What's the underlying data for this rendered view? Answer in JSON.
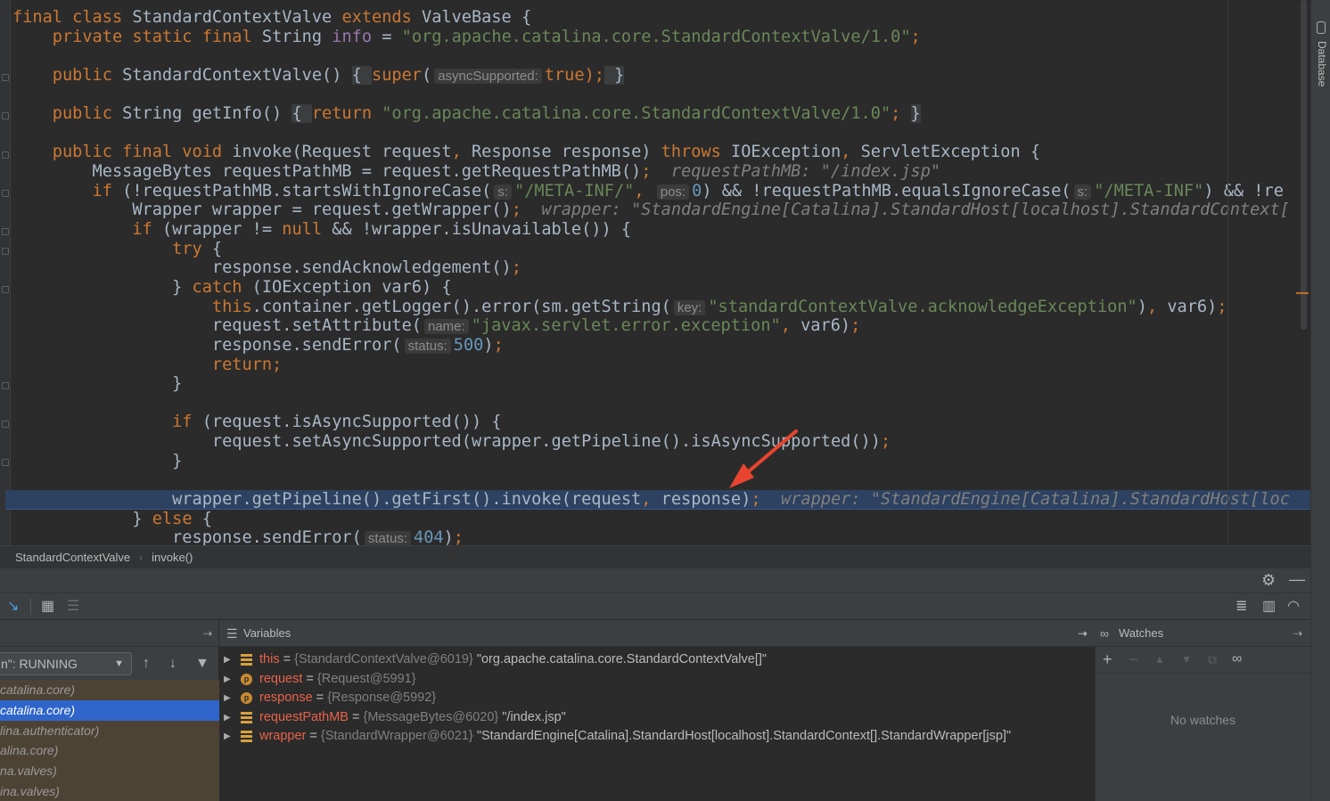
{
  "editor": {
    "lines": [
      [
        {
          "t": "final class ",
          "c": "kw"
        },
        {
          "t": "StandardContextValve "
        },
        {
          "t": "extends ",
          "c": "kw"
        },
        {
          "t": "ValveBase {"
        }
      ],
      [
        {
          "t": "    private static final ",
          "c": "kw"
        },
        {
          "t": "String "
        },
        {
          "t": "info",
          "c": "purple"
        },
        {
          "t": " = "
        },
        {
          "t": "\"org.apache.catalina.core.StandardContextValve/1.0\"",
          "c": "str"
        },
        {
          "t": ";",
          "c": "kw"
        }
      ],
      [],
      [
        {
          "t": "    public ",
          "c": "kw"
        },
        {
          "t": "StandardContextValve() "
        },
        {
          "t": "{ ",
          "c": "fold-brace"
        },
        {
          "t": "super",
          "c": "kw"
        },
        {
          "t": "("
        },
        {
          "t": "asyncSupported:",
          "c": "hint"
        },
        {
          "t": "true",
          "c": "kw"
        },
        {
          "t": ");",
          "c": "kw"
        },
        {
          "t": " }",
          "c": "fold-brace"
        }
      ],
      [],
      [
        {
          "t": "    public ",
          "c": "kw"
        },
        {
          "t": "String getInfo() "
        },
        {
          "t": "{ ",
          "c": "fold-brace"
        },
        {
          "t": "return ",
          "c": "kw"
        },
        {
          "t": "\"org.apache.catalina.core.StandardContextValve/1.0\"",
          "c": "str"
        },
        {
          "t": "; ",
          "c": "kw"
        },
        {
          "t": "}",
          "c": "fold-brace"
        }
      ],
      [],
      [
        {
          "t": "    public final void ",
          "c": "kw"
        },
        {
          "t": "invoke(Request request"
        },
        {
          "t": ", ",
          "c": "kw"
        },
        {
          "t": "Response response) "
        },
        {
          "t": "throws ",
          "c": "kw"
        },
        {
          "t": "IOException"
        },
        {
          "t": ", ",
          "c": "kw"
        },
        {
          "t": "ServletException {"
        }
      ],
      [
        {
          "t": "        MessageBytes requestPathMB = request.getRequestPathMB()"
        },
        {
          "t": ";",
          "c": "kw"
        },
        {
          "t": "  requestPathMB: \"/index.jsp\"",
          "c": "comment"
        }
      ],
      [
        {
          "t": "        if ",
          "c": "kw"
        },
        {
          "t": "(!requestPathMB.startsWithIgnoreCase("
        },
        {
          "t": "s:",
          "c": "hint"
        },
        {
          "t": "\"/META-INF/\"",
          "c": "str"
        },
        {
          "t": ", ",
          "c": "kw"
        },
        {
          "t": "pos:",
          "c": "hint"
        },
        {
          "t": "0",
          "c": "num"
        },
        {
          "t": ") && !requestPathMB.equalsIgnoreCase("
        },
        {
          "t": "s:",
          "c": "hint"
        },
        {
          "t": "\"/META-INF\"",
          "c": "str"
        },
        {
          "t": ") && !re"
        }
      ],
      [
        {
          "t": "            Wrapper wrapper = request.getWrapper()"
        },
        {
          "t": ";",
          "c": "kw"
        },
        {
          "t": "  wrapper: \"StandardEngine[Catalina].StandardHost[localhost].StandardContext[",
          "c": "comment"
        }
      ],
      [
        {
          "t": "            if ",
          "c": "kw"
        },
        {
          "t": "(wrapper != "
        },
        {
          "t": "null ",
          "c": "kw"
        },
        {
          "t": "&& !wrapper.isUnavailable()) {"
        }
      ],
      [
        {
          "t": "                try ",
          "c": "kw"
        },
        {
          "t": "{"
        }
      ],
      [
        {
          "t": "                    response.sendAcknowledgement()"
        },
        {
          "t": ";",
          "c": "kw"
        }
      ],
      [
        {
          "t": "                } "
        },
        {
          "t": "catch ",
          "c": "kw"
        },
        {
          "t": "(IOException var6) {"
        }
      ],
      [
        {
          "t": "                    this",
          "c": "kw"
        },
        {
          "t": ".container.getLogger().error(sm.getString("
        },
        {
          "t": "key:",
          "c": "hint"
        },
        {
          "t": "\"standardContextValve.acknowledgeException\"",
          "c": "str"
        },
        {
          "t": ")"
        },
        {
          "t": ", ",
          "c": "kw"
        },
        {
          "t": "var6)"
        },
        {
          "t": ";",
          "c": "kw"
        }
      ],
      [
        {
          "t": "                    request.setAttribute("
        },
        {
          "t": "name:",
          "c": "hint"
        },
        {
          "t": "\"javax.servlet.error.exception\"",
          "c": "str"
        },
        {
          "t": ", ",
          "c": "kw"
        },
        {
          "t": "var6)"
        },
        {
          "t": ";",
          "c": "kw"
        }
      ],
      [
        {
          "t": "                    response.sendError("
        },
        {
          "t": "status:",
          "c": "hint"
        },
        {
          "t": "500",
          "c": "num"
        },
        {
          "t": ")"
        },
        {
          "t": ";",
          "c": "kw"
        }
      ],
      [
        {
          "t": "                    return;",
          "c": "kw"
        }
      ],
      [
        {
          "t": "                }"
        }
      ],
      [],
      [
        {
          "t": "                if ",
          "c": "kw"
        },
        {
          "t": "(request.isAsyncSupported()) {"
        }
      ],
      [
        {
          "t": "                    request.setAsyncSupported(wrapper.getPipeline().isAsyncSupported())"
        },
        {
          "t": ";",
          "c": "kw"
        }
      ],
      [
        {
          "t": "                }"
        }
      ],
      [],
      [
        {
          "t": "                wrapper.getPipeline().getFirst().invoke(request"
        },
        {
          "t": ", ",
          "c": "kw"
        },
        {
          "t": "response)"
        },
        {
          "t": ";",
          "c": "kw"
        },
        {
          "t": "  wrapper: \"StandardEngine[Catalina].StandardHost[loc",
          "c": "comment"
        }
      ],
      [
        {
          "t": "            } "
        },
        {
          "t": "else ",
          "c": "kw"
        },
        {
          "t": "{"
        }
      ],
      [
        {
          "t": "                response.sendError("
        },
        {
          "t": "status:",
          "c": "hint"
        },
        {
          "t": "404",
          "c": "num"
        },
        {
          "t": ")"
        },
        {
          "t": ";",
          "c": "kw"
        }
      ]
    ],
    "execution_line_index": 25
  },
  "right_strip": {
    "database_tab": "Database"
  },
  "breadcrumb": {
    "class_name": "StandardContextValve",
    "method_name": "invoke()"
  },
  "frames": {
    "thread_select": "n\": RUNNING",
    "items": [
      {
        "label": "catalina.core)",
        "selected": false
      },
      {
        "label": "catalina.core)",
        "selected": true
      },
      {
        "label": "lina.authenticator)",
        "selected": false
      },
      {
        "label": "alina.core)",
        "selected": false
      },
      {
        "label": "na.valves)",
        "selected": false
      },
      {
        "label": "ina.valves)",
        "selected": false
      }
    ]
  },
  "variables": {
    "title": "Variables",
    "items": [
      {
        "icon": "field",
        "name": "this",
        "type": "{StandardContextValve@6019}",
        "value": "\"org.apache.catalina.core.StandardContextValve[]\""
      },
      {
        "icon": "param",
        "icon_letter": "p",
        "name": "request",
        "type": "{Request@5991}",
        "value": ""
      },
      {
        "icon": "param",
        "icon_letter": "p",
        "name": "response",
        "type": "{Response@5992}",
        "value": ""
      },
      {
        "icon": "field",
        "name": "requestPathMB",
        "type": "{MessageBytes@6020}",
        "value": "\"/index.jsp\""
      },
      {
        "icon": "field",
        "name": "wrapper",
        "type": "{StandardWrapper@6021}",
        "value": "\"StandardEngine[Catalina].StandardHost[localhost].StandardContext[].StandardWrapper[jsp]\""
      }
    ]
  },
  "watches": {
    "title": "Watches",
    "empty_text": "No watches"
  },
  "colors": {
    "keyword": "#cc7832",
    "string": "#6a8759",
    "number": "#6897bb",
    "selection": "#2f65ca",
    "exec_line": "#2d4160",
    "annotation_arrow": "#e8442e"
  }
}
